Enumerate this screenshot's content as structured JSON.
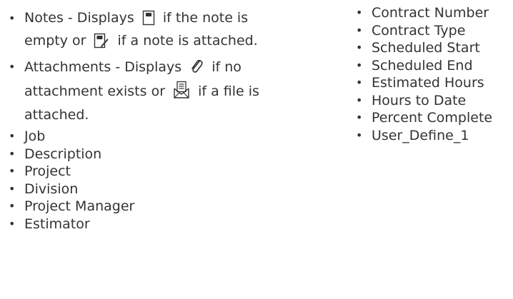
{
  "left_list": {
    "notes": {
      "prefix": "Notes - Displays",
      "middle": "if the note is empty or",
      "suffix": "if a note is attached.",
      "icon_empty": "note-empty-icon",
      "icon_attached": "note-attached-icon"
    },
    "attachments": {
      "prefix": "Attachments - Displays",
      "middle": "if no attachment exists or",
      "suffix": "if a file is attached.",
      "icon_none": "paperclip-icon",
      "icon_attached": "envelope-file-icon"
    },
    "items": [
      "Job",
      "Description",
      "Project",
      "Division",
      "Project Manager",
      "Estimator"
    ]
  },
  "right_list": {
    "items": [
      "Contract Number",
      "Contract Type",
      "Scheduled Start",
      "Scheduled End",
      "Estimated Hours",
      "Hours to Date",
      "Percent Complete",
      "User_Define_1"
    ]
  }
}
